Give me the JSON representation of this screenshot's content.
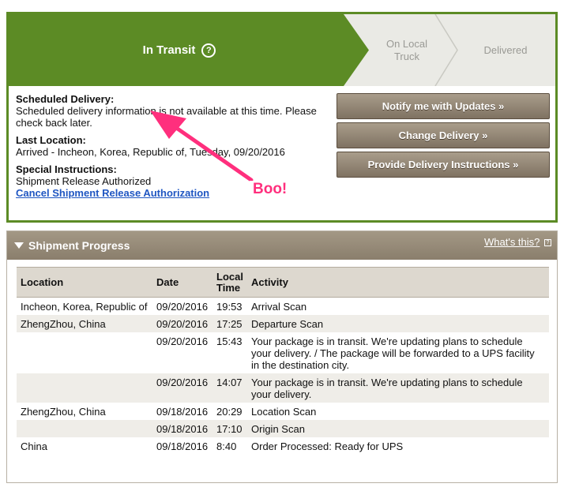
{
  "progress": {
    "current_step": "In Transit",
    "help_icon": "question-circle-icon",
    "step2": "On Local\nTruck",
    "step3": "Delivered",
    "colors": {
      "active": "#5c8b25",
      "inactive": "#eaeae5"
    }
  },
  "details": {
    "scheduled_label": "Scheduled Delivery:",
    "scheduled_value": "Scheduled delivery information is not available at this time. Please check back later.",
    "last_location_label": "Last Location:",
    "last_location_value": "Arrived - Incheon, Korea, Republic of, Tuesday, 09/20/2016",
    "special_label": "Special Instructions:",
    "special_value": "Shipment Release Authorized",
    "cancel_link": "Cancel Shipment Release Authorization"
  },
  "actions": {
    "notify": "Notify me with Updates »",
    "change": "Change Delivery »",
    "provide": "Provide Delivery Instructions »"
  },
  "annotation": {
    "text": "Boo!",
    "color": "#ff2f7d"
  },
  "shipment_progress": {
    "title": "Shipment Progress",
    "whats_this": "What's this?",
    "headers": {
      "location": "Location",
      "date": "Date",
      "time": "Local Time",
      "activity": "Activity"
    },
    "rows": [
      {
        "location": "Incheon, Korea, Republic of",
        "date": "09/20/2016",
        "time": "19:53",
        "activity": "Arrival Scan"
      },
      {
        "location": "ZhengZhou, China",
        "date": "09/20/2016",
        "time": "17:25",
        "activity": "Departure Scan"
      },
      {
        "location": "",
        "date": "09/20/2016",
        "time": "15:43",
        "activity": "Your package is in transit. We're updating plans to schedule your delivery. / The package will be forwarded to a UPS facility in the destination city."
      },
      {
        "location": "",
        "date": "09/20/2016",
        "time": "14:07",
        "activity": "Your package is in transit. We're updating plans to schedule your delivery."
      },
      {
        "location": "ZhengZhou, China",
        "date": "09/18/2016",
        "time": "20:29",
        "activity": "Location Scan"
      },
      {
        "location": "",
        "date": "09/18/2016",
        "time": "17:10",
        "activity": "Origin Scan"
      },
      {
        "location": "China",
        "date": "09/18/2016",
        "time": "8:40",
        "activity": "Order Processed: Ready for UPS"
      }
    ]
  }
}
